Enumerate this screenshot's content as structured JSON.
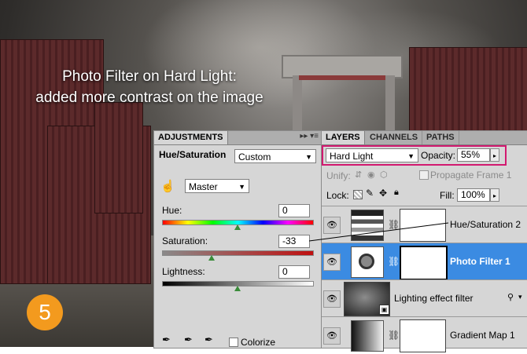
{
  "caption": {
    "line1": "Photo Filter on Hard Light:",
    "line2": "added more contrast on the image"
  },
  "step_badge": "5",
  "adjustments_panel": {
    "tab_label": "ADJUSTMENTS",
    "menu_glyph": "▸▸ ▾≡",
    "title": "Hue/Saturation",
    "preset": "Custom",
    "channel": "Master",
    "hue": {
      "label": "Hue:",
      "value": "0",
      "level": 0.5
    },
    "saturation": {
      "label": "Saturation:",
      "value": "-33",
      "level": 0.33
    },
    "lightness": {
      "label": "Lightness:",
      "value": "0",
      "level": 0.5
    },
    "colorize_label": "Colorize"
  },
  "layers_panel": {
    "tabs": [
      "LAYERS",
      "CHANNELS",
      "PATHS"
    ],
    "blend_mode": "Hard Light",
    "opacity_label": "Opacity:",
    "opacity_value": "55%",
    "unify_label": "Unify:",
    "propagate_label": "Propagate Frame 1",
    "lock_label": "Lock:",
    "fill_label": "Fill:",
    "fill_value": "100%",
    "layers": [
      {
        "name": "Hue/Saturation 2",
        "selected": false
      },
      {
        "name": "Photo Filter 1",
        "selected": true
      },
      {
        "name": "Lighting effect filter",
        "selected": false
      },
      {
        "name": "Gradient Map 1",
        "selected": false
      }
    ]
  },
  "colors": {
    "badge": "#f39a1e",
    "highlight": "#d21970",
    "selection": "#3b8be2"
  }
}
